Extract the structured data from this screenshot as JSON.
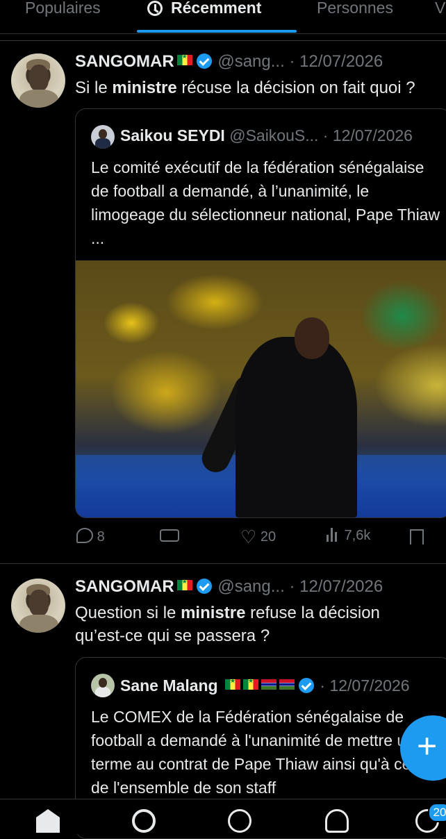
{
  "tabs": [
    {
      "label": "Populaires"
    },
    {
      "label": "Récemment",
      "active": true
    },
    {
      "label": "Personnes"
    },
    {
      "label": "V"
    }
  ],
  "tweets": [
    {
      "name": "SANGOMAR",
      "handle": "@sang...",
      "date": "· 12/07/2026",
      "text_pre": "Si le ",
      "text_bold": "ministre",
      "text_post": " récuse la décision on fait quoi ?",
      "quote": {
        "name": "Saikou SEYDI",
        "handle": "@SaikouS...",
        "date": "· 12/07/2026",
        "text": "Le comité exécutif de la fédération sénégalaise de football a demandé, à l’unanimité, le limogeage du sélectionneur national, Pape Thiaw ..."
      },
      "actions": {
        "replies": "8",
        "likes": "20",
        "views": "7,6k"
      }
    },
    {
      "name": "SANGOMAR",
      "handle": "@sang...",
      "date": "· 12/07/2026",
      "text_pre": "Question si le ",
      "text_bold": "ministre",
      "text_post": " refuse la décision qu’est-ce qui se passera ?",
      "quote": {
        "name": "Sane Malang",
        "date": "· 12/07/2026",
        "text": "Le COMEX de la Fédération sénégalaise de football a demandé à l'unanimité de mettre un terme au contrat de Pape Thiaw ainsi qu'à celui de l'ensemble de son staff"
      }
    }
  ],
  "fab": {
    "label": "+"
  },
  "nav": {
    "badge": "20"
  },
  "colors": {
    "accent": "#1d9bf0",
    "background": "#000000",
    "muted": "#71767b"
  }
}
